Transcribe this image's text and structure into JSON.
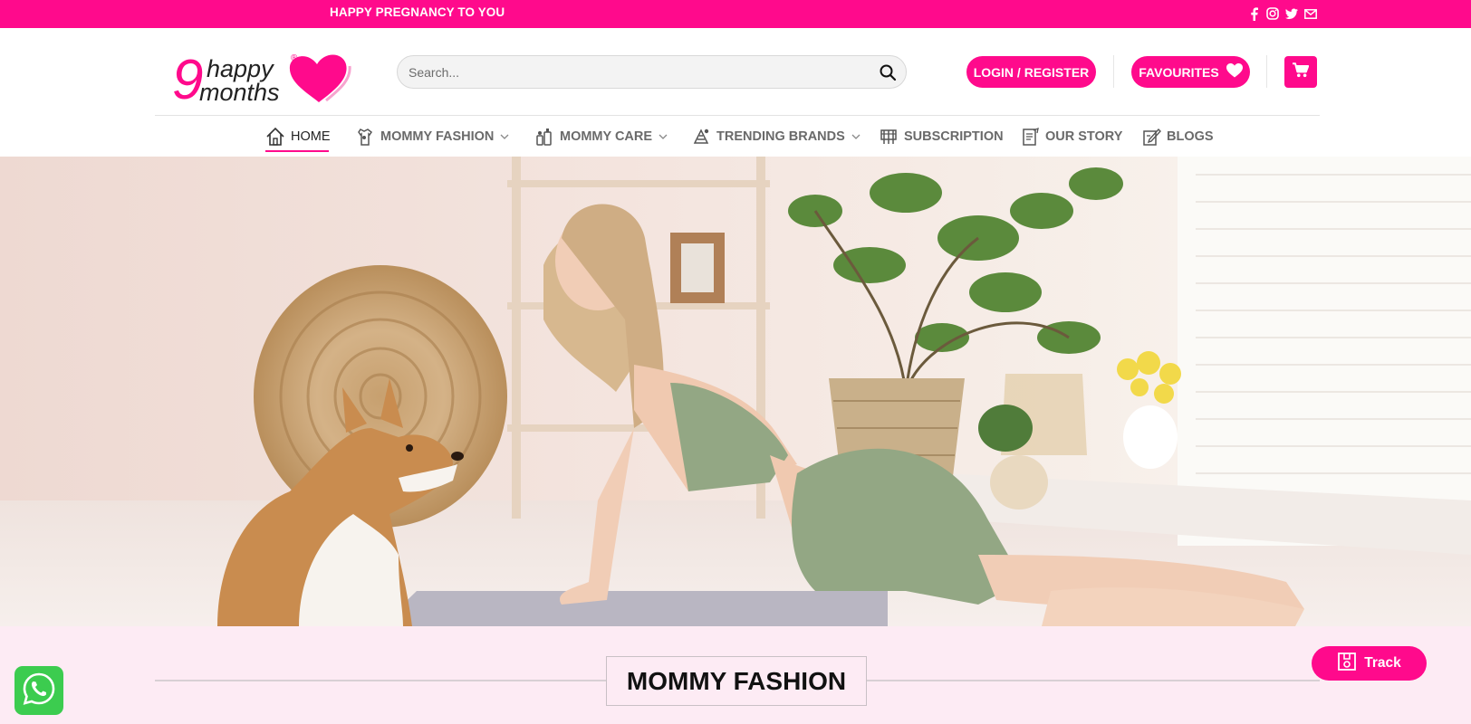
{
  "topbar": {
    "promo_text": "HAPPY PREGNANCY TO YOU",
    "social_icons": [
      "facebook-icon",
      "instagram-icon",
      "twitter-icon",
      "mail-icon"
    ]
  },
  "brand": {
    "logo_number": "9",
    "logo_word1": "happy",
    "logo_word2": "months",
    "logo_mark": "®",
    "accent_color": "#ff0a8c"
  },
  "search": {
    "placeholder": "Search..."
  },
  "header": {
    "login_label": "LOGIN / REGISTER",
    "favourites_label": "FAVOURITES"
  },
  "nav": {
    "items": [
      {
        "label": "HOME",
        "icon": "home-icon",
        "active": true
      },
      {
        "label": "MOMMY FASHION",
        "icon": "fashion-icon",
        "dropdown": true
      },
      {
        "label": "MOMMY CARE",
        "icon": "care-icon",
        "dropdown": true
      },
      {
        "label": "TRENDING BRANDS",
        "icon": "brands-icon",
        "dropdown": true
      },
      {
        "label": "SUBSCRIPTION",
        "icon": "subscription-icon"
      },
      {
        "label": "OUR STORY",
        "icon": "story-icon"
      },
      {
        "label": "BLOGS",
        "icon": "blogs-icon"
      }
    ]
  },
  "section": {
    "title": "MOMMY FASHION"
  },
  "widgets": {
    "track_label": "Track"
  }
}
